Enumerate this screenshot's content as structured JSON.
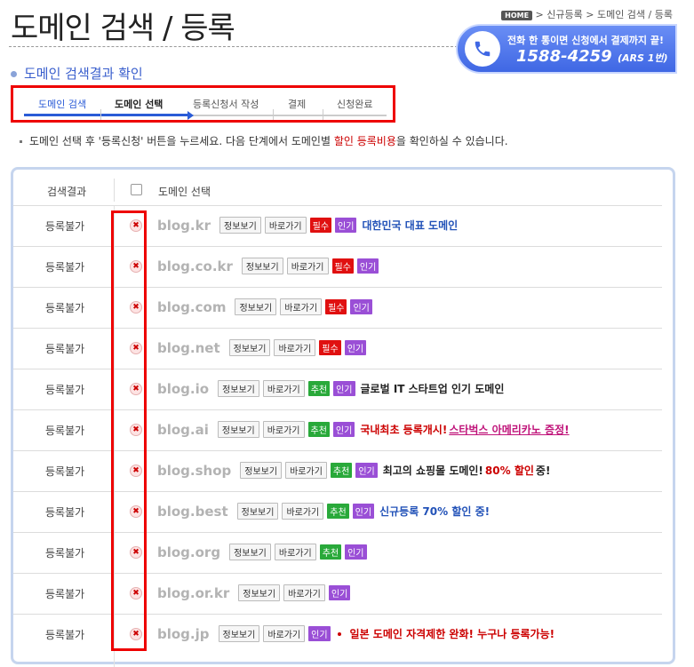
{
  "page_title": "도메인 검색 / 등록",
  "breadcrumb": {
    "home": "HOME",
    "path": "> 신규등록 > 도메인 검색 / 등록"
  },
  "phone_banner": {
    "line1": "전화 한 통이면 신청에서 결제까지 끝!",
    "number": "1588-4259",
    "ars": "(ARS 1번)"
  },
  "section_title": "도메인 검색결과 확인",
  "steps": [
    "도메인 검색",
    "도메인 선택",
    "등록신청서 작성",
    "결제",
    "신청완료"
  ],
  "notice": {
    "pre": "도메인 선택 후 '등록신청' 버튼을 누르세요. 다음 단계에서 도메인별 ",
    "red1": "할인 등록비용",
    "post": "을 확인하실 수 있습니다."
  },
  "table_header": {
    "result": "검색결과",
    "select": "도메인 선택"
  },
  "buttons": {
    "info": "정보보기",
    "goto": "바로가기"
  },
  "badges": {
    "must": "필수",
    "popular": "인기",
    "recommend": "추천"
  },
  "rows": [
    {
      "status": "등록불가",
      "domain": "blog.kr",
      "desc": "대한민국 대표 도메인"
    },
    {
      "status": "등록불가",
      "domain": "blog.co.kr",
      "desc": ""
    },
    {
      "status": "등록불가",
      "domain": "blog.com",
      "desc": ""
    },
    {
      "status": "등록불가",
      "domain": "blog.net",
      "desc": ""
    },
    {
      "status": "등록불가",
      "domain": "blog.io",
      "desc": "글로벌 IT 스타트업 인기 도메인"
    },
    {
      "status": "등록불가",
      "domain": "blog.ai",
      "desc": "국내최초 등록개시!",
      "desc2": "스타벅스 아메리카노 증정!"
    },
    {
      "status": "등록불가",
      "domain": "blog.shop",
      "desc": "최고의 쇼핑몰 도메인!",
      "desc2": "80% 할인",
      "desc3": "중!"
    },
    {
      "status": "등록불가",
      "domain": "blog.best",
      "desc": "신규등록 70% 할인 중!"
    },
    {
      "status": "등록불가",
      "domain": "blog.org",
      "desc": ""
    },
    {
      "status": "등록불가",
      "domain": "blog.or.kr",
      "desc": ""
    },
    {
      "status": "등록불가",
      "domain": "blog.jp",
      "desc": "일본 도메인 자격제한 완화! 누구나 등록가능!"
    }
  ],
  "colors": {
    "accent_blue": "#2a5bd7",
    "highlight_red": "#e00000",
    "badge_must": "#e01010",
    "badge_popular": "#9a4fd6",
    "badge_recommend": "#29a93a"
  }
}
